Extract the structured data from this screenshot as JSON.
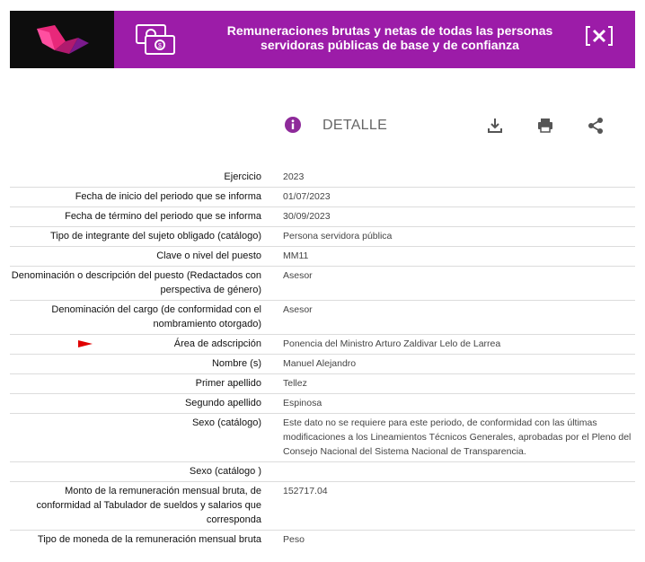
{
  "banner": {
    "title": "Remuneraciones brutas y netas de todas las personas servidoras públicas de base y de confianza",
    "bg_color": "#9c1ca8",
    "icons": {
      "logo": "logo-icon",
      "money": "money-bills-icon",
      "close": "close-icon"
    }
  },
  "toolbar": {
    "detail_label": "DETALLE",
    "icons": [
      "info-icon",
      "download-icon",
      "print-icon",
      "share-icon"
    ]
  },
  "rows": [
    {
      "label": "Ejercicio",
      "value": "2023"
    },
    {
      "label": "Fecha de inicio del periodo que se informa",
      "value": "01/07/2023"
    },
    {
      "label": "Fecha de término del periodo que se informa",
      "value": "30/09/2023"
    },
    {
      "label": "Tipo de integrante del sujeto obligado (catálogo)",
      "value": "Persona servidora pública"
    },
    {
      "label": "Clave o nivel del puesto",
      "value": "MM11"
    },
    {
      "label": "Denominación o descripción del puesto (Redactados con perspectiva de género)",
      "value": "Asesor"
    },
    {
      "label": "Denominación del cargo (de conformidad con el nombramiento otorgado)",
      "value": "Asesor"
    },
    {
      "label": "Área de adscripción",
      "value": "Ponencia del Ministro Arturo Zaldivar Lelo de Larrea",
      "marker": "red-arrow-icon"
    },
    {
      "label": "Nombre (s)",
      "value": "Manuel Alejandro"
    },
    {
      "label": "Primer apellido",
      "value": "Tellez"
    },
    {
      "label": "Segundo apellido",
      "value": "Espinosa"
    },
    {
      "label": "Sexo (catálogo)",
      "value": "Este dato no se requiere para este periodo, de conformidad con las últimas modificaciones a los Lineamientos Técnicos Generales, aprobadas por el Pleno del Consejo Nacional del Sistema Nacional de Transparencia."
    },
    {
      "label": "Sexo (catálogo )",
      "value": ""
    },
    {
      "label": "Monto de la remuneración mensual bruta, de conformidad al Tabulador de sueldos y salarios que corresponda",
      "value": "152717.04"
    },
    {
      "label": "Tipo de moneda de la remuneración mensual bruta",
      "value": "Peso"
    }
  ]
}
